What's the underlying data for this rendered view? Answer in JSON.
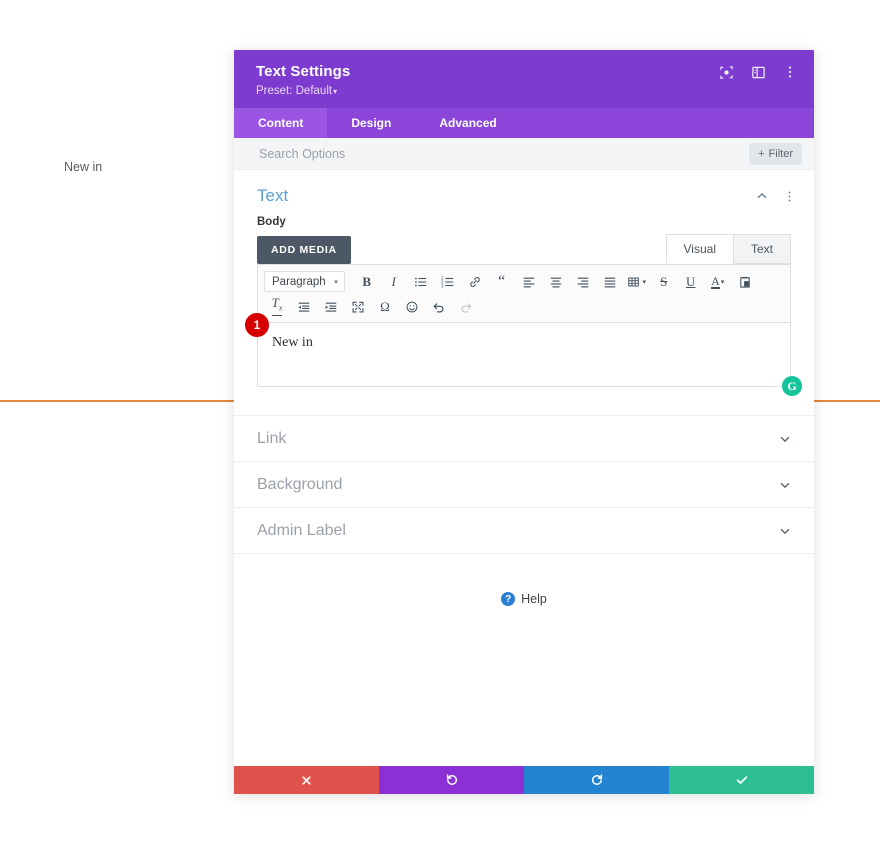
{
  "page_background": {
    "text": "New in",
    "rule_color": "#e8853c"
  },
  "modal": {
    "title": "Text Settings",
    "preset": "Preset: Default",
    "preset_caret": "▾",
    "header_icons": [
      {
        "name": "focus-icon",
        "label": "focus"
      },
      {
        "name": "layout-panel-icon",
        "label": "layout"
      },
      {
        "name": "more-vertical-icon",
        "label": "more"
      }
    ],
    "tabs": [
      {
        "label": "Content",
        "active": true
      },
      {
        "label": "Design",
        "active": false
      },
      {
        "label": "Advanced",
        "active": false
      }
    ],
    "search": {
      "placeholder": "Search Options",
      "value": ""
    },
    "filter_button": {
      "label": "Filter",
      "plus": "+"
    }
  },
  "text_section": {
    "title": "Text",
    "field_label": "Body",
    "add_media_label": "ADD MEDIA",
    "editor_tabs": [
      {
        "label": "Visual",
        "active": true
      },
      {
        "label": "Text",
        "active": false
      }
    ],
    "format_select": {
      "value": "Paragraph",
      "caret": "▾"
    },
    "toolbar_row_1": [
      {
        "name": "bold-icon",
        "glyph": "B"
      },
      {
        "name": "italic-icon",
        "glyph": "I"
      },
      {
        "name": "bulleted-list-icon",
        "glyph": ""
      },
      {
        "name": "numbered-list-icon",
        "glyph": ""
      },
      {
        "name": "link-icon",
        "glyph": ""
      },
      {
        "name": "blockquote-icon",
        "glyph": "“"
      },
      {
        "name": "align-left-icon",
        "glyph": ""
      },
      {
        "name": "align-center-icon",
        "glyph": ""
      },
      {
        "name": "align-right-icon",
        "glyph": ""
      },
      {
        "name": "align-justify-icon",
        "glyph": ""
      },
      {
        "name": "table-icon",
        "glyph": ""
      },
      {
        "name": "strikethrough-icon",
        "glyph": "S"
      },
      {
        "name": "underline-icon",
        "glyph": "U"
      },
      {
        "name": "text-color-icon",
        "glyph": "A"
      },
      {
        "name": "paste-as-text-icon",
        "glyph": ""
      }
    ],
    "toolbar_row_2": [
      {
        "name": "clear-formatting-icon",
        "glyph": "T"
      },
      {
        "name": "outdent-icon",
        "glyph": ""
      },
      {
        "name": "indent-icon",
        "glyph": ""
      },
      {
        "name": "fullscreen-icon",
        "glyph": ""
      },
      {
        "name": "special-character-icon",
        "glyph": "Ω"
      },
      {
        "name": "emoji-icon",
        "glyph": "☺"
      },
      {
        "name": "undo-icon",
        "glyph": ""
      },
      {
        "name": "redo-icon",
        "glyph": "",
        "disabled": true
      }
    ],
    "editor_content": "New in",
    "grammarly_badge": "G",
    "step_badge": "1"
  },
  "collapsed_sections": [
    {
      "label": "Link"
    },
    {
      "label": "Background"
    },
    {
      "label": "Admin Label"
    }
  ],
  "help": {
    "icon_glyph": "?",
    "label": "Help"
  },
  "footer_buttons": [
    {
      "name": "cancel-button",
      "icon": "close-icon",
      "color": "#e0534c"
    },
    {
      "name": "undo-button",
      "icon": "undo-icon",
      "color": "#8b2fd6"
    },
    {
      "name": "redo-button",
      "icon": "redo-icon",
      "color": "#2385d1"
    },
    {
      "name": "save-button",
      "icon": "check-icon",
      "color": "#2dbe93"
    }
  ]
}
